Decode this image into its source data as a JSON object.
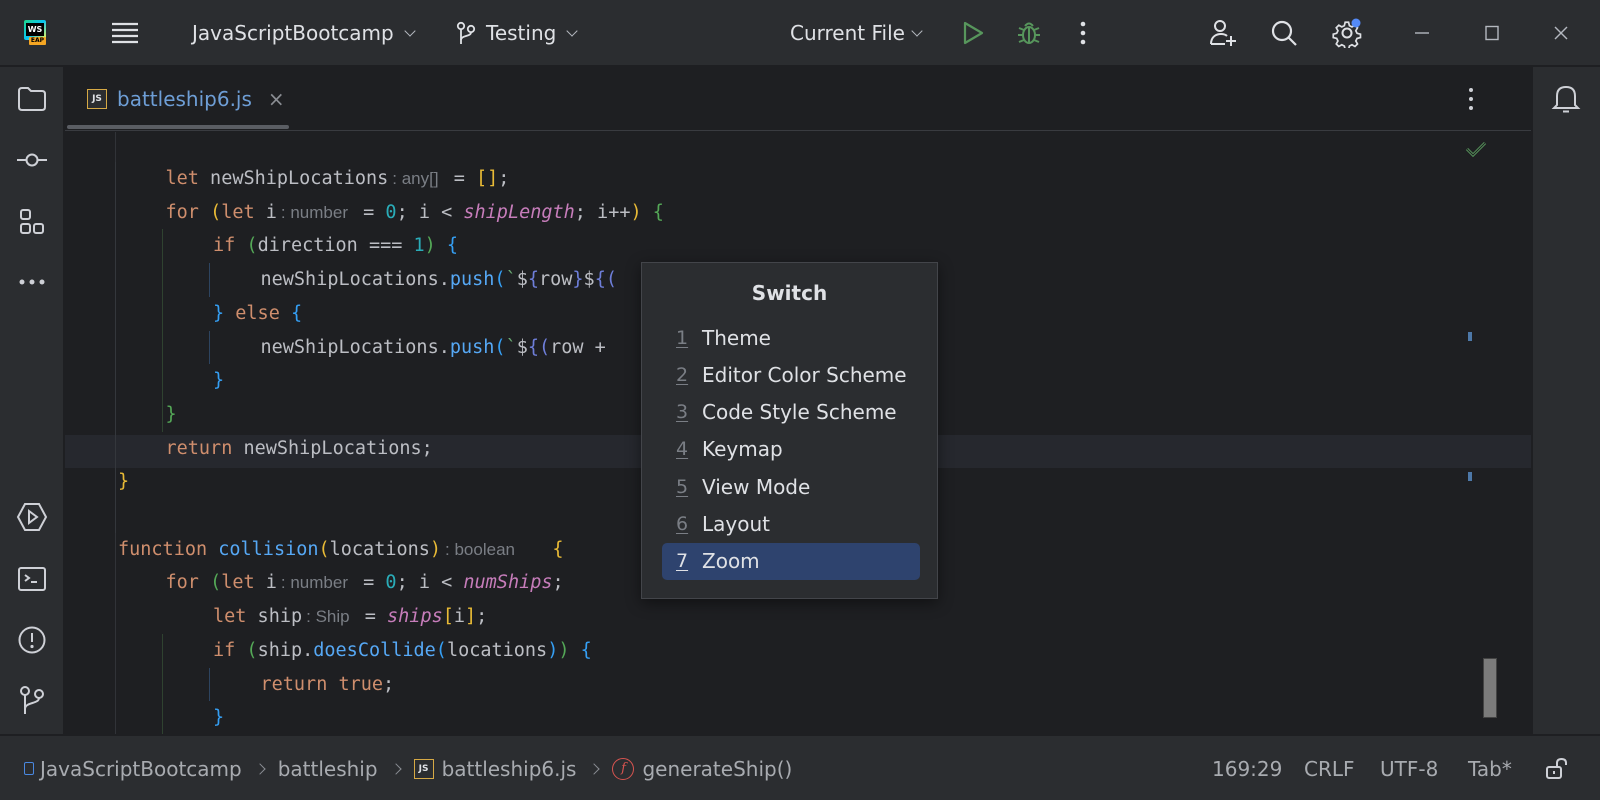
{
  "titlebar": {
    "logo": {
      "top": "WS",
      "badge": "EAP"
    },
    "menu_icon": "hamburger-icon",
    "project": "JavaScriptBootcamp",
    "branch": "Testing",
    "run_config": "Current File",
    "icons": [
      "run-icon",
      "debug-icon",
      "more-vertical-icon",
      "add-user-icon",
      "search-icon",
      "settings-icon",
      "minimize-icon",
      "maximize-icon",
      "close-icon"
    ],
    "run_color": "#57965c",
    "notification_dot_color": "#548af7"
  },
  "left_toolbar": {
    "top": [
      "project-folder-icon",
      "commit-icon",
      "structure-icon",
      "more-horizontal-icon"
    ],
    "bottom": [
      "run-services-icon",
      "terminal-icon",
      "problems-icon",
      "git-icon"
    ]
  },
  "right_toolbar": {
    "items": [
      "notifications-bell-icon"
    ]
  },
  "editor": {
    "tab": {
      "file_icon": "JS",
      "label": "battleship6.js",
      "close": "×"
    },
    "inspection_status": "ok-check-icon",
    "lines": [
      {
        "indent": 1,
        "tokens": [
          [
            "kw",
            "let"
          ],
          [
            "",
            " newShipLocations"
          ],
          [
            "hint",
            ": any[]"
          ],
          [
            "",
            " = "
          ],
          [
            "p1",
            "[]"
          ],
          [
            "",
            ";"
          ]
        ]
      },
      {
        "indent": 1,
        "tokens": [
          [
            "kw",
            "for"
          ],
          [
            "",
            " "
          ],
          [
            "p1",
            "("
          ],
          [
            "kw",
            "let"
          ],
          [
            "",
            " i"
          ],
          [
            "hint",
            ": number"
          ],
          [
            "",
            " = "
          ],
          [
            "num",
            "0"
          ],
          [
            "",
            "; i < "
          ],
          [
            "gv",
            "shipLength"
          ],
          [
            "",
            "; i++"
          ],
          [
            "p1",
            ")"
          ],
          [
            "",
            " "
          ],
          [
            "p2",
            "{"
          ]
        ]
      },
      {
        "indent": 2,
        "tokens": [
          [
            "kw",
            "if"
          ],
          [
            "",
            " "
          ],
          [
            "p2",
            "("
          ],
          [
            "",
            "direction === "
          ],
          [
            "num",
            "1"
          ],
          [
            "p2",
            ")"
          ],
          [
            "",
            " "
          ],
          [
            "p3",
            "{"
          ]
        ]
      },
      {
        "indent": 3,
        "tokens": [
          [
            "",
            "newShipLocations."
          ],
          [
            "fn",
            "push"
          ],
          [
            "p3",
            "("
          ],
          [
            "tpl",
            "`"
          ],
          [
            "",
            "$"
          ],
          [
            "p4",
            "{"
          ],
          [
            "",
            "row"
          ],
          [
            "p4",
            "}"
          ],
          [
            "",
            "$"
          ],
          [
            "p4",
            "{("
          ]
        ]
      },
      {
        "indent": 2,
        "tokens": [
          [
            "p3",
            "}"
          ],
          [
            "",
            " "
          ],
          [
            "kw",
            "else"
          ],
          [
            "",
            " "
          ],
          [
            "p3",
            "{"
          ]
        ]
      },
      {
        "indent": 3,
        "tokens": [
          [
            "",
            "newShipLocations."
          ],
          [
            "fn",
            "push"
          ],
          [
            "p3",
            "("
          ],
          [
            "tpl",
            "`"
          ],
          [
            "",
            "$"
          ],
          [
            "p4",
            "{("
          ],
          [
            "",
            "row +"
          ]
        ]
      },
      {
        "indent": 2,
        "tokens": [
          [
            "p3",
            "}"
          ]
        ]
      },
      {
        "indent": 1,
        "tokens": [
          [
            "p2",
            "}"
          ]
        ]
      },
      {
        "indent": 1,
        "tokens": [
          [
            "kw",
            "return"
          ],
          [
            "",
            " newShipLocations;"
          ]
        ]
      },
      {
        "indent": 0,
        "tokens": [
          [
            "p1",
            "}"
          ]
        ]
      },
      {
        "indent": 0,
        "tokens": []
      },
      {
        "indent": 0,
        "tokens": [
          [
            "kw",
            "function"
          ],
          [
            "",
            " "
          ],
          [
            "fn",
            "collision"
          ],
          [
            "p1",
            "("
          ],
          [
            "",
            "locations"
          ],
          [
            "p1",
            ")"
          ],
          [
            "hint",
            ": boolean"
          ],
          [
            "",
            "   "
          ],
          [
            "p1",
            "{"
          ]
        ]
      },
      {
        "indent": 1,
        "tokens": [
          [
            "kw",
            "for"
          ],
          [
            "",
            " "
          ],
          [
            "p2",
            "("
          ],
          [
            "kw",
            "let"
          ],
          [
            "",
            " i"
          ],
          [
            "hint",
            ": number"
          ],
          [
            "",
            " = "
          ],
          [
            "num",
            "0"
          ],
          [
            "",
            "; i < "
          ],
          [
            "gv",
            "numShips"
          ],
          [
            "",
            ";"
          ]
        ]
      },
      {
        "indent": 2,
        "tokens": [
          [
            "kw",
            "let"
          ],
          [
            "",
            " ship"
          ],
          [
            "hint",
            ": Ship"
          ],
          [
            "",
            " = "
          ],
          [
            "gv",
            "ships"
          ],
          [
            "p1",
            "["
          ],
          [
            "",
            "i"
          ],
          [
            "p1",
            "]"
          ],
          [
            "",
            ";"
          ]
        ]
      },
      {
        "indent": 2,
        "tokens": [
          [
            "kw",
            "if"
          ],
          [
            "",
            " "
          ],
          [
            "p2",
            "("
          ],
          [
            "",
            "ship."
          ],
          [
            "fn",
            "doesCollide"
          ],
          [
            "p3",
            "("
          ],
          [
            "",
            "locations"
          ],
          [
            "p3",
            ")"
          ],
          [
            "p2",
            ")"
          ],
          [
            "",
            " "
          ],
          [
            "p3",
            "{"
          ]
        ]
      },
      {
        "indent": 3,
        "tokens": [
          [
            "kw",
            "return"
          ],
          [
            "",
            " "
          ],
          [
            "kw",
            "true"
          ],
          [
            "",
            ";"
          ]
        ]
      },
      {
        "indent": 2,
        "tokens": [
          [
            "p3",
            "}"
          ]
        ]
      }
    ]
  },
  "switch_popup": {
    "title": "Switch",
    "items": [
      {
        "num": "1",
        "label": "Theme",
        "selected": false
      },
      {
        "num": "2",
        "label": "Editor Color Scheme",
        "selected": false
      },
      {
        "num": "3",
        "label": "Code Style Scheme",
        "selected": false
      },
      {
        "num": "4",
        "label": "Keymap",
        "selected": false
      },
      {
        "num": "5",
        "label": "View Mode",
        "selected": false
      },
      {
        "num": "6",
        "label": "Layout",
        "selected": false
      },
      {
        "num": "7",
        "label": "Zoom",
        "selected": true
      }
    ]
  },
  "statusbar": {
    "breadcrumbs": [
      {
        "icon": "module-icon",
        "label": "JavaScriptBootcamp"
      },
      {
        "icon": "",
        "label": "battleship"
      },
      {
        "icon": "js-file-icon",
        "label": "battleship6.js"
      },
      {
        "icon": "function-icon",
        "label": "generateShip()"
      }
    ],
    "position": "169:29",
    "line_separator": "CRLF",
    "encoding": "UTF-8",
    "indent": "Tab*",
    "lock_icon": "unlocked-icon"
  }
}
